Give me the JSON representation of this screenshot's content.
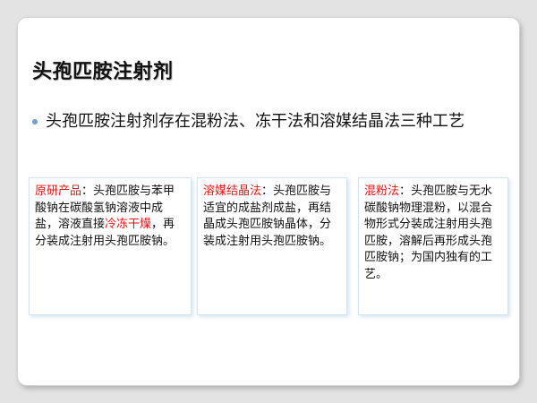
{
  "slide": {
    "title": "头孢匹胺注射剂",
    "bullet": "头孢匹胺注射剂存在混粉法、冻干法和溶媒结晶法三种工艺",
    "boxes": [
      {
        "heading": "原研产品",
        "text_before": "：头孢匹胺与苯甲酸钠在碳酸氢钠溶液中成盐，溶液直接",
        "highlight": "冷冻干燥",
        "text_after": "，再分装成注射用头孢匹胺钠。"
      },
      {
        "heading": "溶媒结晶法",
        "text": "：头孢匹胺与适宜的成盐剂成盐，再结晶成头孢匹胺钠晶体，分装成注射用头孢匹胺钠。"
      },
      {
        "heading": "混粉法",
        "text": "：头孢匹胺与无水碳酸钠物理混粉，以混合物形式分装成注射用头孢匹胺，溶解后再形成头孢匹胺钠；为国内独有的工艺。"
      }
    ]
  },
  "colors": {
    "highlight_red": "#ee1111",
    "bullet_blue": "#6f9fcf",
    "box_border": "#d3e4f0",
    "page_background": "#e3e3e3"
  }
}
